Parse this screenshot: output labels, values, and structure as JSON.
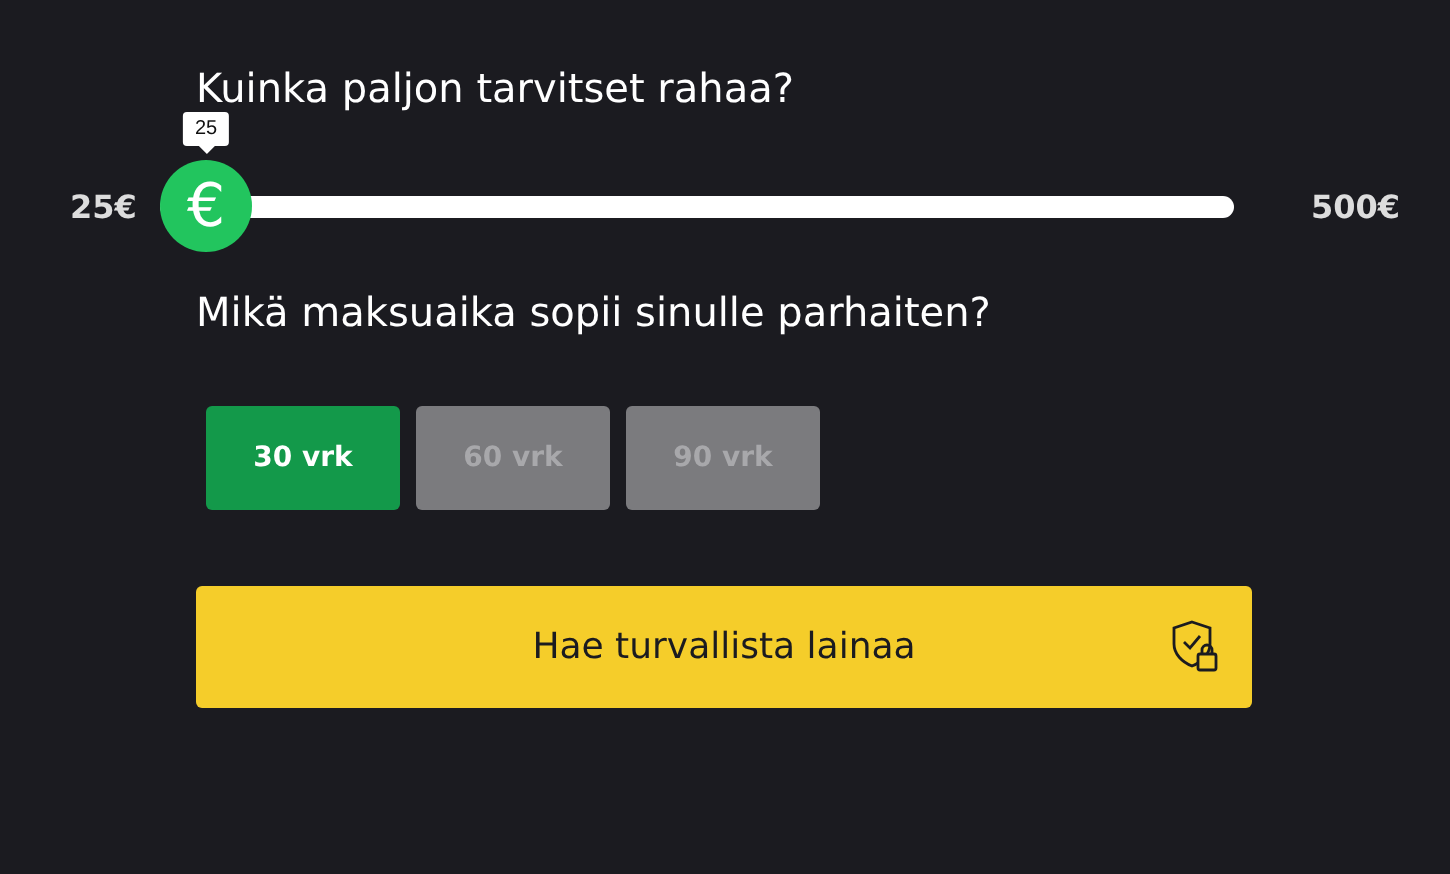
{
  "amount": {
    "question": "Kuinka paljon tarvitset rahaa?",
    "min_label": "25€",
    "max_label": "500€",
    "tooltip": "25",
    "thumb_symbol": "€",
    "level": 0
  },
  "period": {
    "question": "Mikä maksuaika sopii sinulle parhaiten?",
    "options": [
      {
        "label": "30 vrk",
        "selected": true
      },
      {
        "label": "60 vrk",
        "selected": false
      },
      {
        "label": "90 vrk",
        "selected": false
      }
    ]
  },
  "submit": {
    "label": "Hae turvallista lainaa"
  }
}
